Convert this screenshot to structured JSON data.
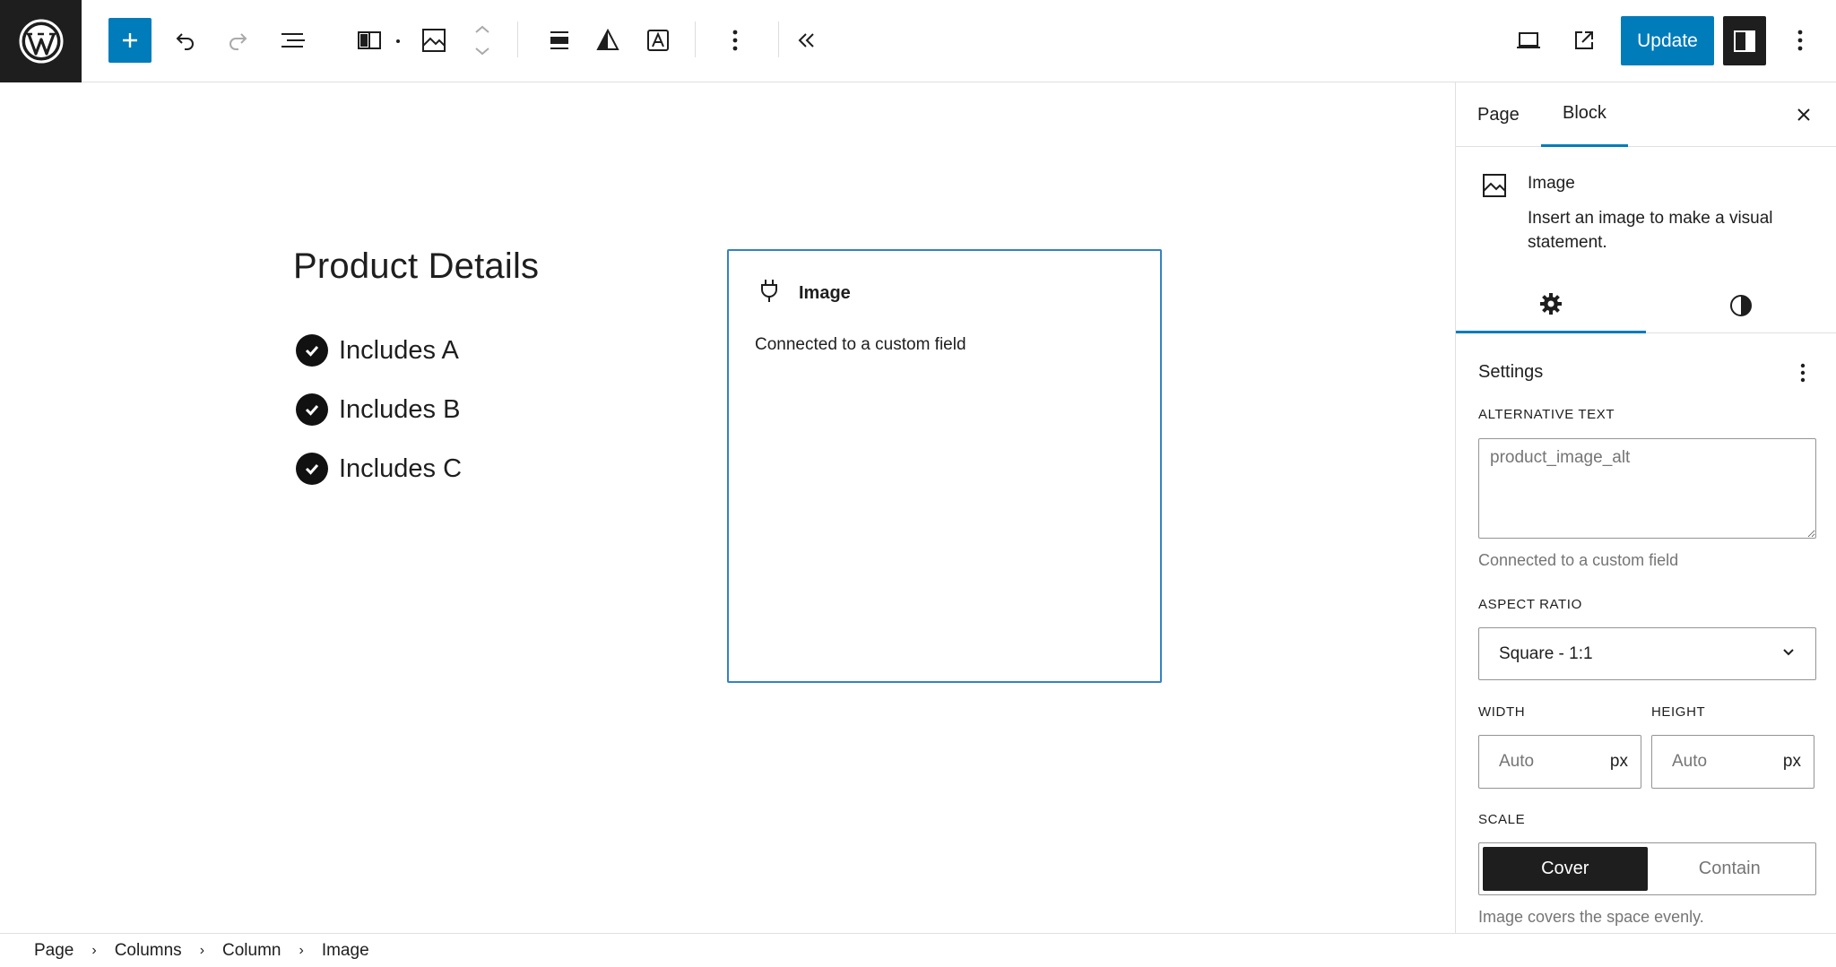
{
  "toolbar": {
    "update_label": "Update"
  },
  "canvas": {
    "heading": "Product Details",
    "list": [
      "Includes A",
      "Includes B",
      "Includes C"
    ],
    "image_block": {
      "title": "Image",
      "text": "Connected to a custom field"
    }
  },
  "sidebar": {
    "tabs": [
      "Page",
      "Block"
    ],
    "block": {
      "name": "Image",
      "description": "Insert an image to make a visual statement."
    },
    "settings_title": "Settings",
    "alt_label": "ALTERNATIVE TEXT",
    "alt_placeholder": "product_image_alt",
    "alt_help": "Connected to a custom field",
    "aspect_label": "ASPECT RATIO",
    "aspect_value": "Square - 1:1",
    "width_label": "WIDTH",
    "height_label": "HEIGHT",
    "width_placeholder": "Auto",
    "height_placeholder": "Auto",
    "unit": "px",
    "scale_label": "SCALE",
    "scale_options": [
      "Cover",
      "Contain"
    ],
    "scale_help": "Image covers the space evenly."
  },
  "breadcrumbs": [
    "Page",
    "Columns",
    "Column",
    "Image"
  ],
  "colors": {
    "accent": "#007cba",
    "dark": "#1e1e1e",
    "selection": "#3582c4"
  }
}
